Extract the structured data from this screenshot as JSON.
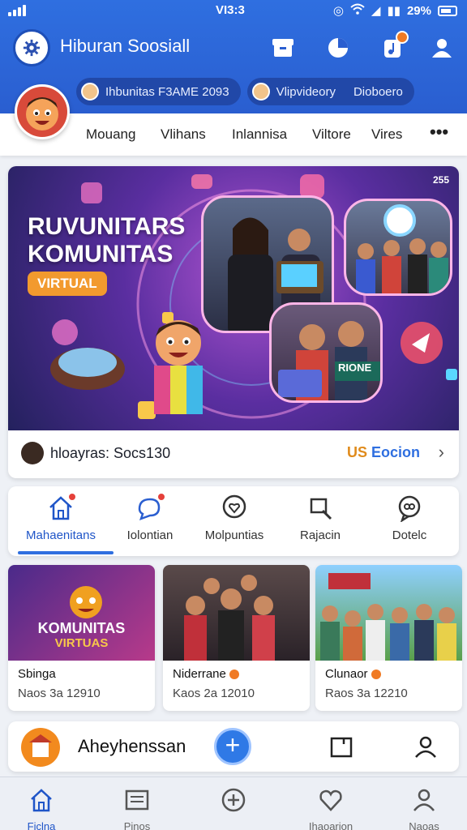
{
  "status": {
    "time": "VI3:3",
    "battery": "29%"
  },
  "header": {
    "title": "Hiburan Soosiall"
  },
  "chips": [
    {
      "label": "Ihbunitas F3AME 2093"
    },
    {
      "label": "Vlipvideory",
      "extra": "Dioboero"
    }
  ],
  "subnav": [
    "Mouang",
    "Vlihans",
    "Inlannisa",
    "Viltore",
    "Vires"
  ],
  "hero": {
    "badge": "255",
    "title_line1": "RUVUNITARS",
    "title_line2": "KOMUNITAS",
    "tag": "VIRTUAL",
    "footer_text": "hloayras: Socs130",
    "footer_link_prefix": "US",
    "footer_link_text": "Eocion",
    "photo_sign": "RIONE"
  },
  "tabs": [
    {
      "label": "Mahaenitans"
    },
    {
      "label": "Iolontian"
    },
    {
      "label": "Molpuntias"
    },
    {
      "label": "Rajacin"
    },
    {
      "label": "Dotelc"
    }
  ],
  "cards": [
    {
      "overlay1": "KOMUNITAS",
      "overlay2": "VIRTUAS",
      "name": "Sbinga",
      "meta": "Naos 3a 12910"
    },
    {
      "name": "Niderrane",
      "meta": "Kaos 2a 12010"
    },
    {
      "name": "Clunaor",
      "meta": "Raos 3a 12210"
    }
  ],
  "composer": {
    "text": "Aheyhenssan"
  },
  "bottom_nav": [
    {
      "label": "Ficlna"
    },
    {
      "label": "Pinos"
    },
    {
      "label": ""
    },
    {
      "label": "Ihaoarion"
    },
    {
      "label": "Naoas"
    }
  ],
  "colors": {
    "primary": "#2f6fe0",
    "accent": "#f29a2e",
    "alert": "#e5403a"
  }
}
